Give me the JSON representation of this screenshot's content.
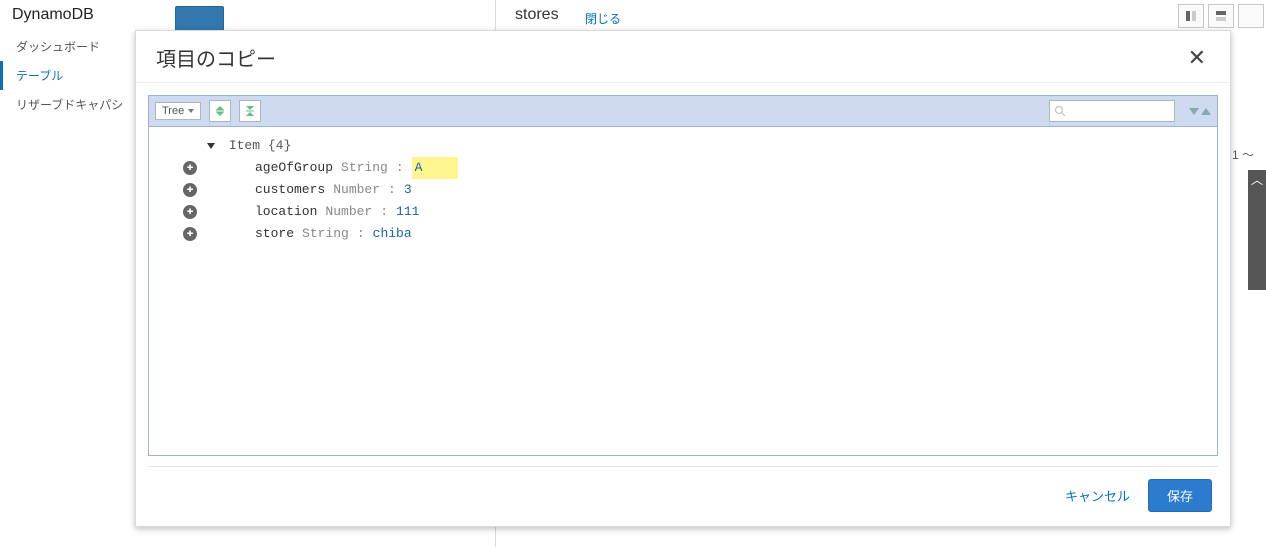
{
  "background": {
    "service_title": "DynamoDB",
    "sidebar": [
      "ダッシュボード",
      "テーブル",
      "リザーブドキャパシ"
    ],
    "sidebar_active_index": 1,
    "table_name": "stores",
    "close_label": "閉じる",
    "pager_text": "1 ～"
  },
  "modal": {
    "title": "項目のコピー",
    "close_glyph": "✕",
    "toolbar": {
      "tree_label": "Tree"
    },
    "search": {
      "placeholder": ""
    },
    "tree": {
      "root_label": "Item",
      "root_count": "{4}",
      "attributes": [
        {
          "name": "ageOfGroup",
          "type": "String",
          "value": "A",
          "editing": true
        },
        {
          "name": "customers",
          "type": "Number",
          "value": "3",
          "editing": false
        },
        {
          "name": "location",
          "type": "Number",
          "value": "111",
          "editing": false
        },
        {
          "name": "store",
          "type": "String",
          "value": "chiba",
          "editing": false
        }
      ]
    },
    "footer": {
      "cancel": "キャンセル",
      "save": "保存"
    }
  }
}
